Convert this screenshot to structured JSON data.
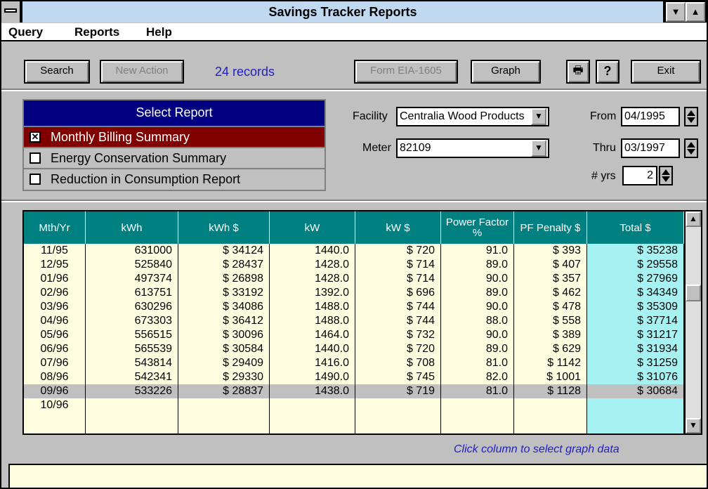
{
  "window": {
    "title": "Savings Tracker Reports"
  },
  "menu": [
    "Query",
    "Reports",
    "Help"
  ],
  "toolbar": {
    "search": "Search",
    "new_action": "New Action",
    "records": "24 records",
    "form": "Form EIA-1605",
    "graph": "Graph",
    "exit": "Exit",
    "print_icon": "printer-icon",
    "help_icon": "question-icon"
  },
  "report_panel": {
    "title": "Select Report",
    "items": [
      {
        "label": "Monthly Billing Summary",
        "checked": true
      },
      {
        "label": "Energy Conservation Summary",
        "checked": false
      },
      {
        "label": "Reduction in Consumption Report",
        "checked": false
      }
    ]
  },
  "filters": {
    "facility_label": "Facility",
    "facility_value": "Centralia Wood Products",
    "meter_label": "Meter",
    "meter_value": "82109",
    "from_label": "From",
    "from_value": "04/1995",
    "thru_label": "Thru",
    "thru_value": "03/1997",
    "years_label": "# yrs",
    "years_value": "2"
  },
  "table": {
    "columns": [
      "Mth/Yr",
      "kWh",
      "kWh $",
      "kW",
      "kW $",
      "Power Factor %",
      "PF Penalty $",
      "Total $"
    ],
    "rows": [
      [
        "11/95",
        "631000",
        "$ 34124",
        "1440.0",
        "$ 720",
        "91.0",
        "$ 393",
        "$ 35238"
      ],
      [
        "12/95",
        "525840",
        "$ 28437",
        "1428.0",
        "$ 714",
        "89.0",
        "$ 407",
        "$ 29558"
      ],
      [
        "01/96",
        "497374",
        "$ 26898",
        "1428.0",
        "$ 714",
        "90.0",
        "$ 357",
        "$ 27969"
      ],
      [
        "02/96",
        "613751",
        "$ 33192",
        "1392.0",
        "$ 696",
        "89.0",
        "$ 462",
        "$ 34349"
      ],
      [
        "03/96",
        "630296",
        "$ 34086",
        "1488.0",
        "$ 744",
        "90.0",
        "$ 478",
        "$ 35309"
      ],
      [
        "04/96",
        "673303",
        "$ 36412",
        "1488.0",
        "$ 744",
        "88.0",
        "$ 558",
        "$ 37714"
      ],
      [
        "05/96",
        "556515",
        "$ 30096",
        "1464.0",
        "$ 732",
        "90.0",
        "$ 389",
        "$ 31217"
      ],
      [
        "06/96",
        "565539",
        "$ 30584",
        "1440.0",
        "$ 720",
        "89.0",
        "$ 629",
        "$ 31934"
      ],
      [
        "07/96",
        "543814",
        "$ 29409",
        "1416.0",
        "$ 708",
        "81.0",
        "$ 1142",
        "$ 31259"
      ],
      [
        "08/96",
        "542341",
        "$ 29330",
        "1490.0",
        "$ 745",
        "82.0",
        "$ 1001",
        "$ 31076"
      ],
      [
        "09/96",
        "533226",
        "$ 28837",
        "1438.0",
        "$ 719",
        "81.0",
        "$ 1128",
        "$ 30684"
      ],
      [
        "10/96",
        "",
        "",
        "",
        "",
        "",
        "",
        ""
      ]
    ],
    "highlighted_row": 10
  },
  "hint": "Click column to select graph data"
}
